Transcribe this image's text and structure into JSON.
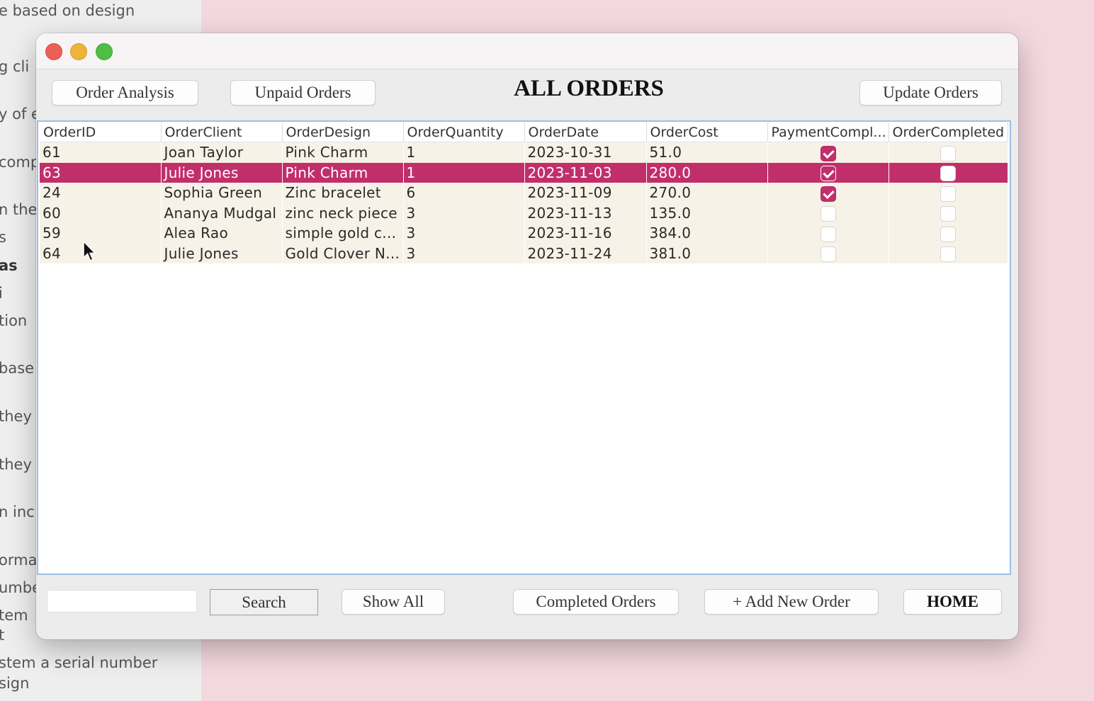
{
  "background_doc": {
    "lines": [
      "e based on design",
      "g cli",
      "y of e",
      "comp",
      "n the",
      "s",
      "as",
      "i",
      "tion",
      "base",
      "they",
      "they",
      "n inc",
      "orma",
      "umbe",
      "tem",
      "t",
      "stem a serial number",
      "sign"
    ]
  },
  "window": {
    "heading": "ALL ORDERS",
    "toolbar": {
      "order_analysis": "Order Analysis",
      "unpaid_orders": "Unpaid Orders",
      "update_orders": "Update Orders"
    },
    "footer": {
      "search_value": "",
      "search": "Search",
      "show_all": "Show All",
      "completed_orders": "Completed Orders",
      "add_new_order": "+ Add New Order",
      "home": "HOME"
    }
  },
  "table": {
    "columns": [
      "OrderID",
      "OrderClient",
      "OrderDesign",
      "OrderQuantity",
      "OrderDate",
      "OrderCost",
      "PaymentCompl...",
      "OrderCompleted"
    ],
    "selected_row_index": 1,
    "rows": [
      {
        "id": "61",
        "client": "Joan Taylor",
        "design": "Pink Charm",
        "qty": "1",
        "date": "2023-10-31",
        "cost": "51.0",
        "paid": true,
        "completed": false
      },
      {
        "id": "63",
        "client": "Julie Jones",
        "design": "Pink Charm",
        "qty": "1",
        "date": "2023-11-03",
        "cost": "280.0",
        "paid": true,
        "completed": false
      },
      {
        "id": "24",
        "client": "Sophia Green",
        "design": "Zinc bracelet",
        "qty": "6",
        "date": "2023-11-09",
        "cost": "270.0",
        "paid": true,
        "completed": false
      },
      {
        "id": "60",
        "client": "Ananya Mudgal",
        "design": "zinc neck piece",
        "qty": "3",
        "date": "2023-11-13",
        "cost": "135.0",
        "paid": false,
        "completed": false
      },
      {
        "id": "59",
        "client": "Alea Rao",
        "design": "simple gold c...",
        "qty": "3",
        "date": "2023-11-16",
        "cost": "384.0",
        "paid": false,
        "completed": false
      },
      {
        "id": "64",
        "client": "Julie Jones",
        "design": "Gold Clover N...",
        "qty": "3",
        "date": "2023-11-24",
        "cost": "381.0",
        "paid": false,
        "completed": false
      }
    ]
  },
  "colors": {
    "accent": "#c12f6b",
    "row_bg": "#f7f2e7",
    "desktop_bg": "#f3d8df"
  },
  "icons": [
    "close-icon",
    "minimize-icon",
    "zoom-icon",
    "mouse-pointer-icon"
  ]
}
